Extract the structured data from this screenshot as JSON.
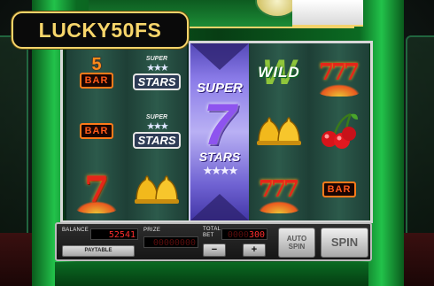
{
  "promo_badge": "LUCKY50FS",
  "reels": {
    "col1": [
      "5",
      "BAR",
      "BAR",
      "7"
    ],
    "col2": [
      "SUPER",
      "STARS",
      "SUPER",
      "STARS"
    ],
    "col3": {
      "super": "SUPER",
      "seven": "7",
      "stars": "STARS"
    },
    "col4": [
      "WILD",
      "W"
    ],
    "col5_bar": "BAR",
    "seven_glyph": "7"
  },
  "controls": {
    "balance_label": "BALANCE",
    "balance_value": "52541",
    "balance_dim": " ",
    "prize_label": "PRIZE",
    "prize_value": "00000000",
    "total_bet_label_1": "TOTAL",
    "total_bet_label_2": "BET",
    "total_bet_value": "300",
    "total_bet_dim": "0000",
    "paytable_label": "PAYTABLE",
    "minus_label": "−",
    "plus_label": "+",
    "autospin_line1": "AUTO",
    "autospin_line2": "SPIN",
    "spin_label": "SPIN"
  },
  "colors": {
    "cabinet_green": "#22c24a",
    "badge_gold": "#f7d66b",
    "display_red": "#ff2d2d",
    "super7_purple": "#8e54ef"
  }
}
